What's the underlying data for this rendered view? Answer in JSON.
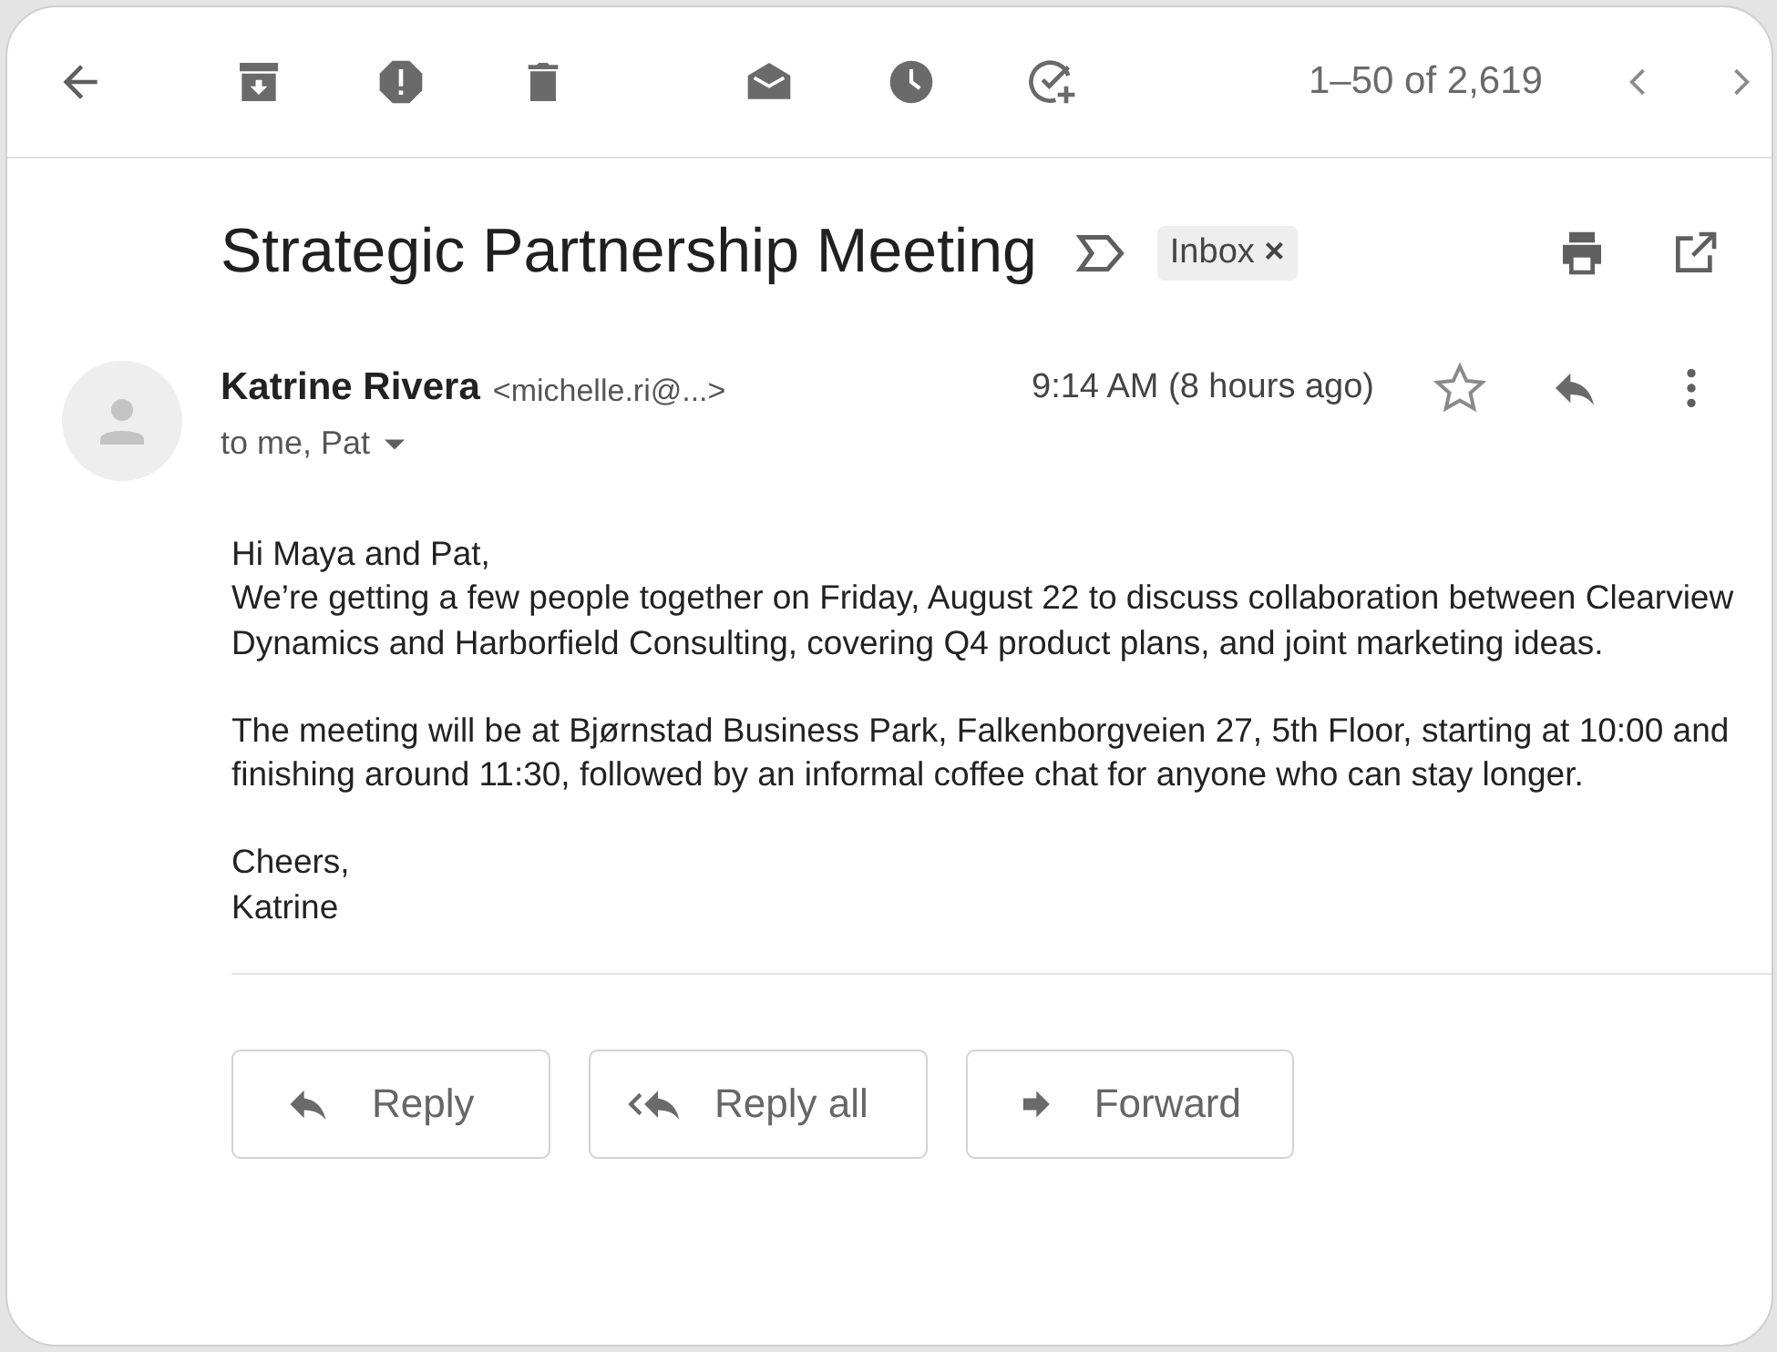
{
  "toolbar": {
    "pager": "1–50 of 2,619"
  },
  "message": {
    "subject": "Strategic Partnership Meeting",
    "label": {
      "text": "Inbox",
      "remove": "×"
    },
    "sender": {
      "name": "Katrine Rivera",
      "email": "<michelle.ri@...>"
    },
    "time": "9:14 AM",
    "ago": "(8 hours ago)",
    "starred": false,
    "recipients": "to me, Pat",
    "body": [
      "Hi Maya and Pat,\nWe’re getting a few people together on Friday, August 22 to discuss collaboration between Clearview Dynamics and Harborfield Consulting, covering Q4 product plans, and joint marketing ideas.",
      "The meeting will be at Bjørnstad Business Park, Falkenborgveien 27, 5th Floor, starting at 10:00 and finishing around 11:30, followed by an informal coffee chat for anyone who can stay longer.",
      "Cheers,\nKatrine"
    ]
  },
  "actions": [
    {
      "kind": "reply",
      "label": "Reply"
    },
    {
      "kind": "reply_all",
      "label": "Reply all"
    },
    {
      "kind": "forward",
      "label": "Forward"
    }
  ]
}
